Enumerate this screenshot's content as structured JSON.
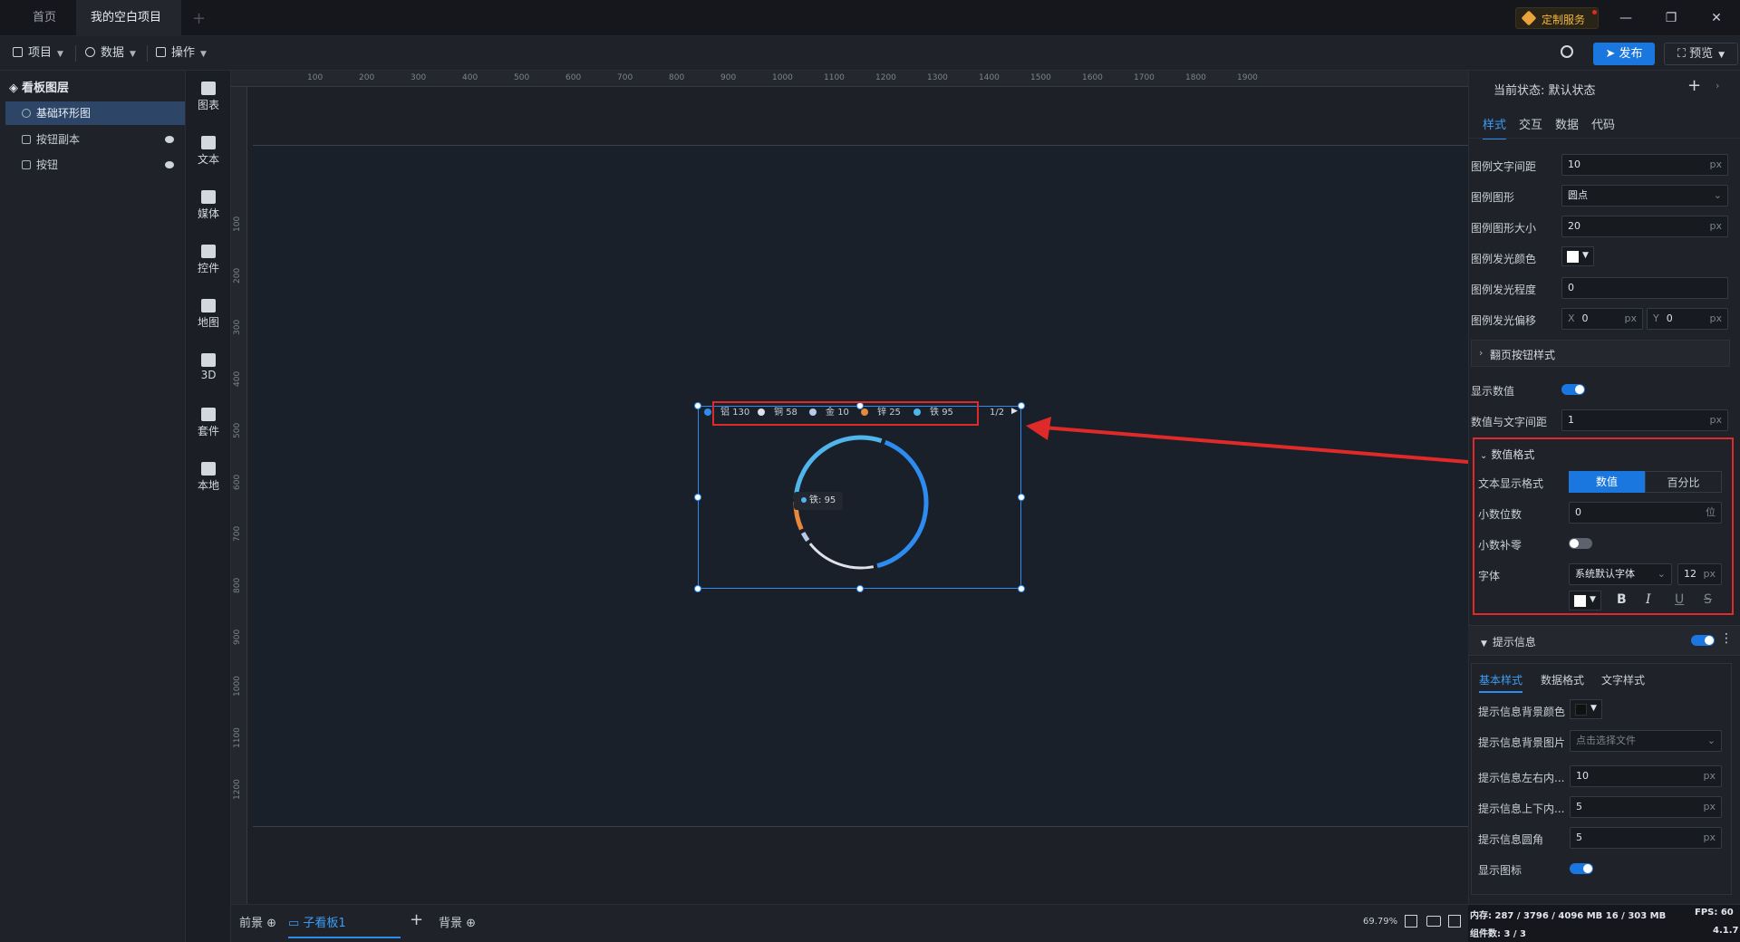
{
  "tabs": [
    {
      "label": "首页"
    },
    {
      "label": "我的空白项目"
    }
  ],
  "custom_service": "定制服务",
  "toolbar": {
    "project": "项目",
    "data": "数据",
    "operate": "操作",
    "publish": "发布",
    "preview": "预览"
  },
  "layers": {
    "title": "看板图层",
    "items": [
      {
        "label": "基础环形图"
      },
      {
        "label": "按钮副本"
      },
      {
        "label": "按钮"
      }
    ]
  },
  "components": [
    "图表",
    "文本",
    "媒体",
    "控件",
    "地图",
    "3D",
    "套件",
    "本地"
  ],
  "ruler": {
    "top": [
      "100",
      "200",
      "300",
      "400",
      "500",
      "600",
      "700",
      "800",
      "900",
      "1000",
      "1100",
      "1200",
      "1300",
      "1400",
      "1500",
      "1600",
      "1700",
      "1800",
      "1900"
    ],
    "left": [
      "100",
      "200",
      "300",
      "400",
      "500",
      "600",
      "700",
      "800",
      "900",
      "1000",
      "1100",
      "1200"
    ]
  },
  "chart_data": {
    "type": "pie",
    "categories": [
      "铝",
      "铜",
      "金",
      "锌",
      "铁"
    ],
    "values": [
      130,
      58,
      10,
      25,
      95
    ],
    "page": "1/2",
    "tooltip": {
      "label": "铁",
      "value": "95"
    }
  },
  "bottom": {
    "front": "前景",
    "sub_board": "子看板1",
    "bg": "背景",
    "zoom": "69.79%"
  },
  "panel": {
    "state_label": "当前状态:",
    "state_value": "默认状态",
    "tabs": [
      "样式",
      "交互",
      "数据",
      "代码"
    ],
    "legend_text_gap": {
      "label": "图例文字间距",
      "value": "10",
      "unit": "px"
    },
    "legend_shape": {
      "label": "图例图形",
      "value": "圆点"
    },
    "legend_shape_size": {
      "label": "图例图形大小",
      "value": "20",
      "unit": "px"
    },
    "legend_glow_color": {
      "label": "图例发光颜色",
      "color": "#ffffff"
    },
    "legend_glow_level": {
      "label": "图例发光程度",
      "value": "0"
    },
    "legend_glow_offset": {
      "label": "图例发光偏移",
      "x_label": "X",
      "x": "0",
      "y_label": "Y",
      "y": "0",
      "unit": "px"
    },
    "page_btn_style": "翻页按钮样式",
    "show_value": {
      "label": "显示数值",
      "on": true
    },
    "value_text_gap": {
      "label": "数值与文字间距",
      "value": "1",
      "unit": "px"
    },
    "value_format": {
      "title": "数值格式",
      "display_label": "文本显示格式",
      "option_value": "数值",
      "option_percent": "百分比",
      "decimals_label": "小数位数",
      "decimals": "0",
      "decimals_unit": "位",
      "pad_zero_label": "小数补零",
      "font_label": "字体",
      "font_value": "系统默认字体",
      "font_size": "12",
      "font_unit": "px"
    },
    "tooltip": {
      "title": "提示信息",
      "tabs": [
        "基本样式",
        "数据格式",
        "文字样式"
      ],
      "bg_color_label": "提示信息背景颜色",
      "bg_color": "#111111",
      "bg_image_label": "提示信息背景图片",
      "bg_image_placeholder": "点击选择文件",
      "pad_lr_label": "提示信息左右内...",
      "pad_lr": "10",
      "pad_tb_label": "提示信息上下内...",
      "pad_tb": "5",
      "radius_label": "提示信息圆角",
      "radius": "5",
      "show_icon_label": "显示图标",
      "unit": "px"
    }
  },
  "status": {
    "memory": "内存: 287 / 3796 / 4096 MB  16 / 303 MB",
    "fps": "FPS: 60",
    "components": "组件数: 3 / 3",
    "version": "4.1.7"
  }
}
